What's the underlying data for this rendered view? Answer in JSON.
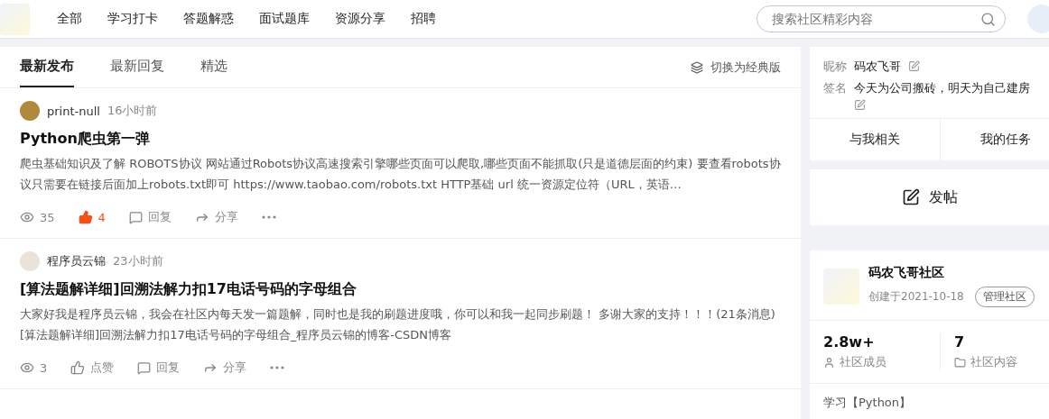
{
  "header": {
    "nav": [
      {
        "label": "全部"
      },
      {
        "label": "学习打卡"
      },
      {
        "label": "答题解惑"
      },
      {
        "label": "面试题库"
      },
      {
        "label": "资源分享"
      },
      {
        "label": "招聘"
      }
    ],
    "search": {
      "placeholder": "搜索社区精彩内容"
    }
  },
  "feed": {
    "tabs": [
      {
        "label": "最新发布",
        "selected": true
      },
      {
        "label": "最新回复",
        "selected": false
      },
      {
        "label": "精选",
        "selected": false
      }
    ],
    "switch_label": "切换为经典版",
    "posts": [
      {
        "author": "print-null",
        "time": "16小时前",
        "title": "Python爬虫第一弹",
        "excerpt": "爬虫基础知识及了解 ROBOTS协议  网站通过Robots协议高速搜索引擎哪些页面可以爬取,哪些页面不能抓取(只是道德层面的约束) 要查看robots协议只需要在链接后面加上robots.txt即可 https://www.taobao.com/robots.txt HTTP基础 url 统一资源定位符（URL，英语…",
        "views": "35",
        "liked": true,
        "like_label": "4",
        "reply_label": "回复",
        "share_label": "分享"
      },
      {
        "author": "程序员云锦",
        "time": "23小时前",
        "title": "[算法题解详细]回溯法解力扣17电话号码的字母组合",
        "excerpt": "大家好我是程序员云锦，我会在社区内每天发一篇题解，同时也是我的刷题进度哦，你可以和我一起同步刷题！  多谢大家的支持！！！(21条消息) [算法题解详细]回溯法解力扣17电话号码的字母组合_程序员云锦的博客-CSDN博客",
        "views": "3",
        "liked": false,
        "like_label": "点赞",
        "reply_label": "回复",
        "share_label": "分享"
      }
    ]
  },
  "profile": {
    "nickname_label": "昵称",
    "nickname": "码农飞哥",
    "signature_label": "签名",
    "signature": "今天为公司搬砖，明天为自己建房",
    "links": [
      {
        "label": "与我相关"
      },
      {
        "label": "我的任务"
      }
    ]
  },
  "post_button": "发帖",
  "community": {
    "name": "码农飞哥社区",
    "created": "创建于2021-10-18",
    "manage": "管理社区",
    "stats": [
      {
        "kind": "members",
        "value": "2.8w+",
        "label": "社区成员"
      },
      {
        "kind": "content",
        "value": "7",
        "label": "社区内容"
      }
    ],
    "intro": "学习【Python】"
  }
}
